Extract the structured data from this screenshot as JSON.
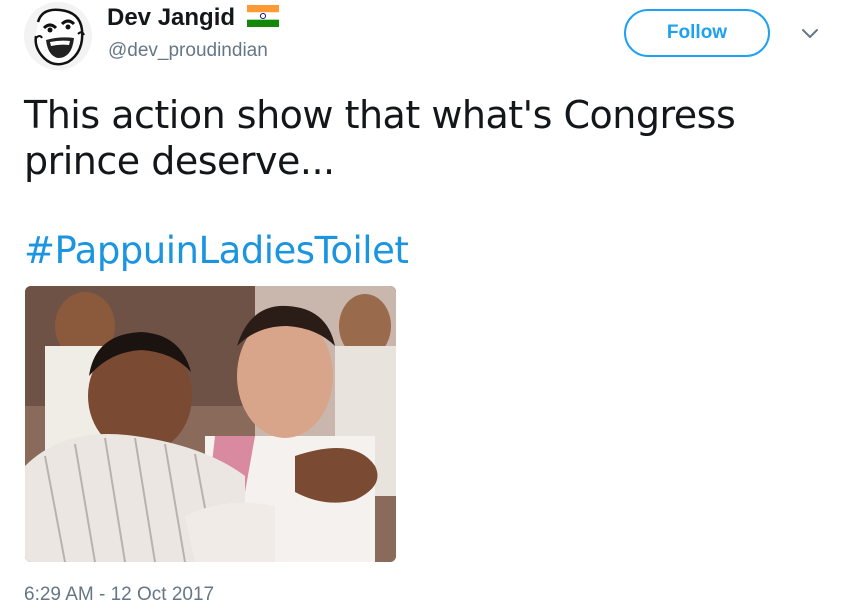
{
  "author": {
    "display_name": "Dev Jangid",
    "handle": "@dev_proudindian",
    "avatar_icon": "laughing-face-icon",
    "badge_icon": "india-flag-icon"
  },
  "follow_button": {
    "label": "Follow"
  },
  "menu": {
    "icon": "chevron-down-icon"
  },
  "tweet": {
    "text": "This action show that what's Congress prince deserve...",
    "hashtag": "#PappuinLadiesToilet",
    "timestamp": "6:29 AM - 12 Oct 2017"
  },
  "colors": {
    "accent": "#1da1f2",
    "link": "#1b95e0",
    "secondary_text": "#657786",
    "primary_text": "#14171a"
  }
}
